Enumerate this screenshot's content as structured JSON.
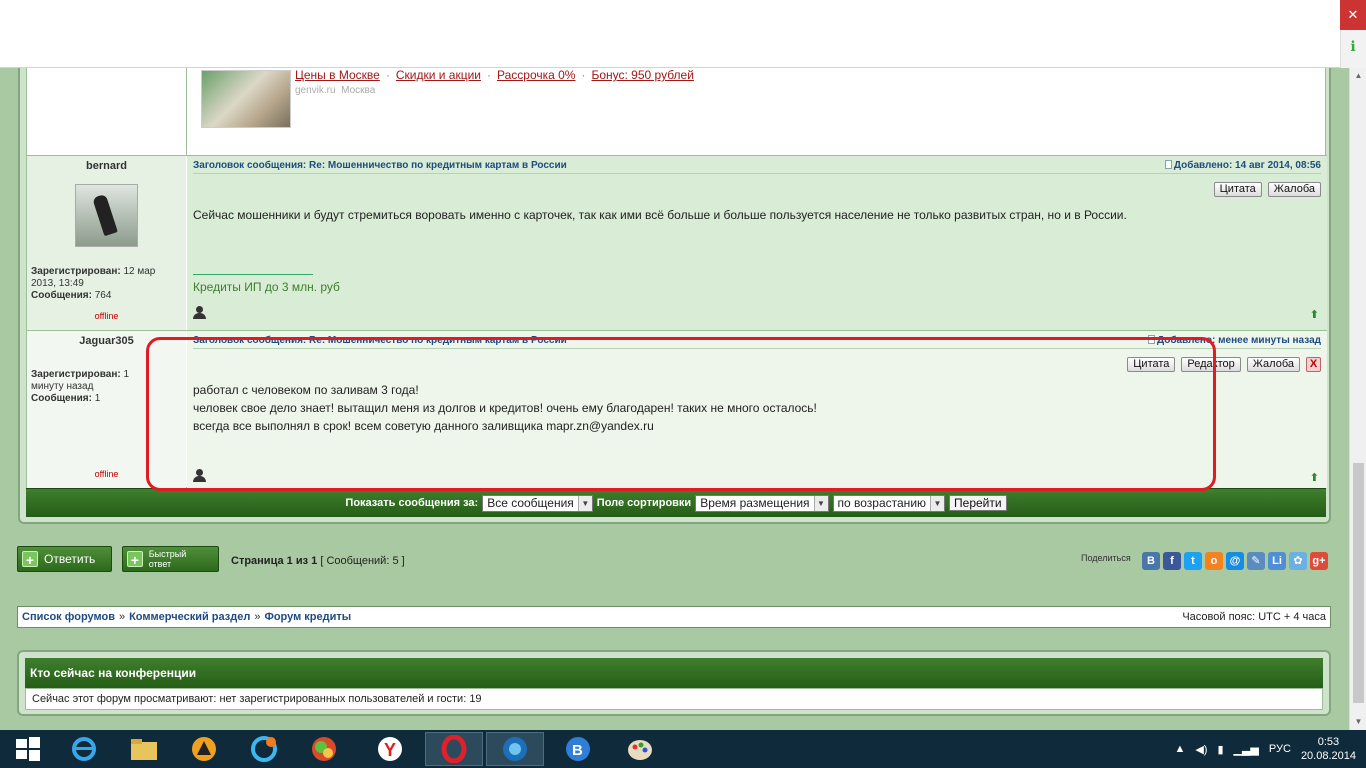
{
  "ad": {
    "links": [
      "Цены в Москве",
      "Скидки и акции",
      "Рассрочка 0%",
      "Бонус: 950 рублей"
    ],
    "domain": "genvik.ru",
    "city": "Москва"
  },
  "posts": [
    {
      "author": "bernard",
      "registered_label": "Зарегистрирован:",
      "registered_value": "12 мар 2013, 13:49",
      "messages_label": "Сообщения:",
      "messages_value": "764",
      "status": "offline",
      "subject": "Заголовок сообщения: Re: Мошенничество по кредитным картам в России",
      "date": "Добавлено: 14 авг 2014, 08:56",
      "buttons": [
        "Цитата",
        "Жалоба"
      ],
      "text": "Сейчас мошенники и будут стремиться воровать именно с карточек, так как ими всё больше и больше пользуется население не только развитых стран, но и в России.",
      "signature": "Кредиты ИП до 3 млн. руб"
    },
    {
      "author": "Jaguar305",
      "registered_label": "Зарегистрирован:",
      "registered_value": "1 минуту назад",
      "messages_label": "Сообщения:",
      "messages_value": "1",
      "status": "offline",
      "subject": "Заголовок сообщения: Re: Мошенничество по кредитным картам в России",
      "date": "Добавлено: менее минуты назад",
      "buttons": [
        "Цитата",
        "Редактор",
        "Жалоба"
      ],
      "delete_label": "X",
      "lines": [
        "работал с человеком по заливам 3 года!",
        "человек свое дело знает! вытащил меня из долгов и кредитов! очень ему благодарен! таких не много осталось!",
        "всегда все выполнял в срок! всем советую данного заливщика mapr.zn@yandex.ru"
      ]
    }
  ],
  "sortbar": {
    "show_label": "Показать сообщения за:",
    "show_value": "Все сообщения",
    "sort_label": "Поле сортировки",
    "sort_value": "Время размещения",
    "order_value": "по возрастанию",
    "go_label": "Перейти"
  },
  "actions": {
    "reply": "Ответить",
    "quick_reply": "Быстрый ответ",
    "page_prefix": "Страница",
    "page_current": "1",
    "page_of": "из",
    "page_total": "1",
    "messages_count": "[ Сообщений: 5 ]",
    "share_label": "Поделиться"
  },
  "social_icons": [
    {
      "name": "vk-icon",
      "glyph": "B",
      "color": "#4a76a8"
    },
    {
      "name": "facebook-icon",
      "glyph": "f",
      "color": "#3b5998"
    },
    {
      "name": "twitter-icon",
      "glyph": "t",
      "color": "#1da1f2"
    },
    {
      "name": "odnoklassniki-icon",
      "glyph": "o",
      "color": "#f58220"
    },
    {
      "name": "mailru-icon",
      "glyph": "@",
      "color": "#168de2"
    },
    {
      "name": "livejournal-icon",
      "glyph": "✎",
      "color": "#5a8cc0"
    },
    {
      "name": "liveinternet-icon",
      "glyph": "Li",
      "color": "#4f8fd4"
    },
    {
      "name": "moikrug-icon",
      "glyph": "✿",
      "color": "#6ab0e0"
    },
    {
      "name": "googleplus-icon",
      "glyph": "g+",
      "color": "#dd4b39"
    }
  ],
  "breadcrumb": {
    "items": [
      "Список форумов",
      "Коммерческий раздел",
      "Форум кредиты"
    ],
    "separator": "»",
    "timezone": "Часовой пояс: UTC + 4 часа"
  },
  "online": {
    "title": "Кто сейчас на конференции",
    "text": "Сейчас этот форум просматривают: нет зарегистрированных пользователей и гости: 19"
  },
  "taskbar": {
    "language": "РУС",
    "time": "0:53",
    "date": "20.08.2014"
  }
}
